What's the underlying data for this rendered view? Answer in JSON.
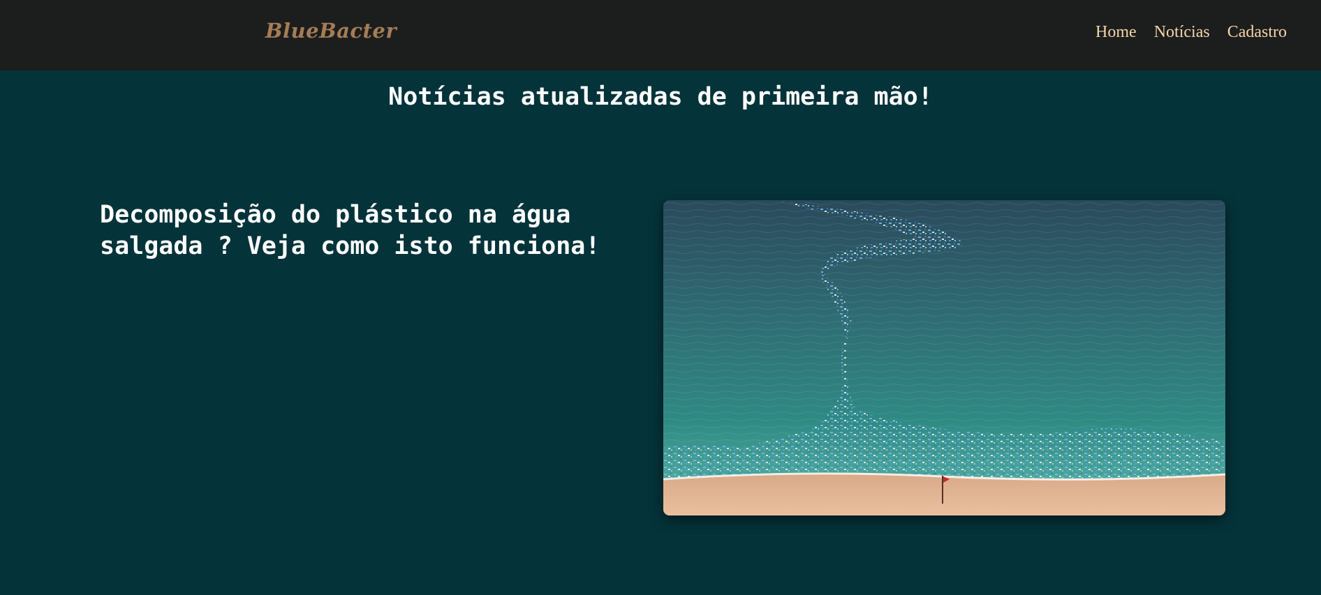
{
  "navbar": {
    "brand": "BlueBacter",
    "links": [
      "Home",
      "Notícias",
      "Cadastro"
    ]
  },
  "main": {
    "title": "Notícias atualizadas de primeira mão!",
    "news": [
      {
        "headline": "Decomposição do plástico na água salgada ? Veja como isto funciona!",
        "image": "ocean-plastic-pollution-photo"
      }
    ]
  },
  "colors": {
    "navbar_bg": "#1c1d1d",
    "page_bg": "#04333a",
    "brand": "#a47d55",
    "nav_link": "#f3d6a8",
    "text": "#ffffff"
  }
}
